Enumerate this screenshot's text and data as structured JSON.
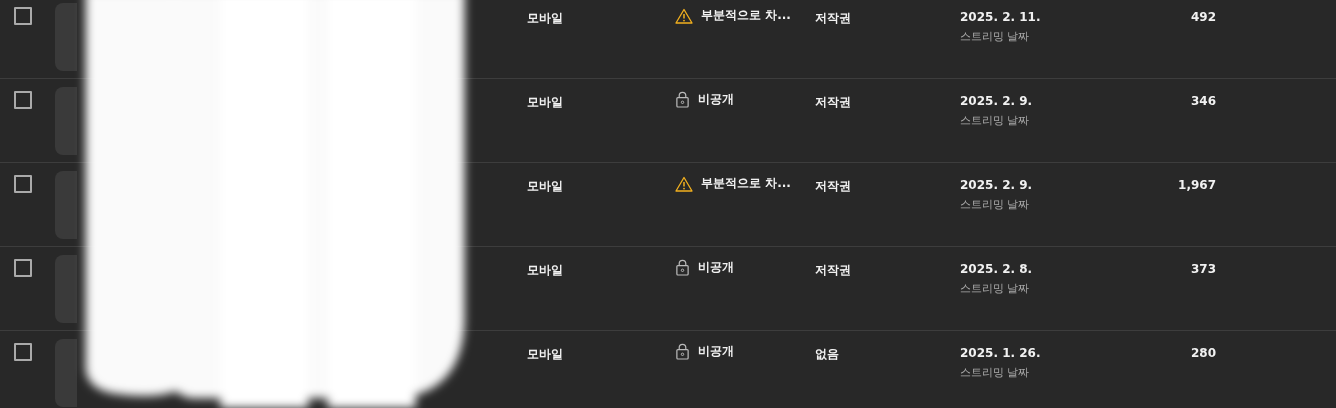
{
  "rows": [
    {
      "checked": false,
      "type": "모바일",
      "visibility": {
        "kind": "warning",
        "label": "부분적으로 차..."
      },
      "restriction": "저작권",
      "date": "2025. 2. 11.",
      "date_note": "스트리밍 날짜",
      "views": "492"
    },
    {
      "checked": false,
      "type": "모바일",
      "visibility": {
        "kind": "private",
        "label": "비공개"
      },
      "restriction": "저작권",
      "date": "2025. 2. 9.",
      "date_note": "스트리밍 날짜",
      "views": "346"
    },
    {
      "checked": false,
      "type": "모바일",
      "visibility": {
        "kind": "warning",
        "label": "부분적으로 차..."
      },
      "restriction": "저작권",
      "date": "2025. 2. 9.",
      "date_note": "스트리밍 날짜",
      "views": "1,967"
    },
    {
      "checked": false,
      "type": "모바일",
      "visibility": {
        "kind": "private",
        "label": "비공개"
      },
      "restriction": "저작권",
      "date": "2025. 2. 8.",
      "date_note": "스트리밍 날짜",
      "views": "373"
    },
    {
      "checked": false,
      "type": "모바일",
      "visibility": {
        "kind": "private",
        "label": "비공개"
      },
      "restriction": "없음",
      "date": "2025. 1. 26.",
      "date_note": "스트리밍 날짜",
      "views": "280"
    }
  ]
}
